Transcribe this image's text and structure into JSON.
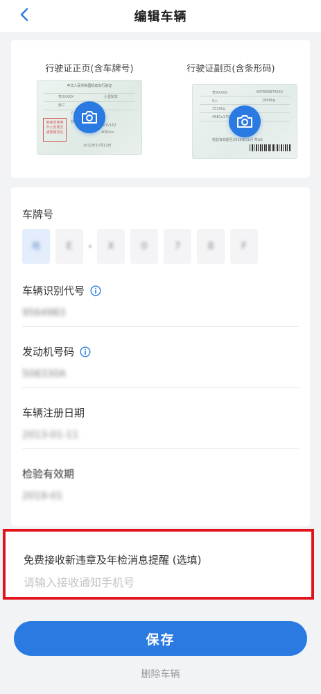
{
  "header": {
    "title": "编辑车辆",
    "back_icon": "back-chevron-icon"
  },
  "photos": {
    "front": {
      "label": "行驶证正页(含车牌号)",
      "sample_title": "中华人民共和国机动车行驶证",
      "sample_lines": [
        "粤XXXXX",
        "小型轿车",
        "张三",
        "广东省",
        "非营运",
        "2012年12月12日",
        "LVTV152",
        "4081cc"
      ],
      "stamp_text": "某某省某某市公安局交通警察支队",
      "icon": "camera-icon"
    },
    "back": {
      "label": "行驶证副页(含条形码)",
      "sample_lines": [
        "粤XXXXX",
        "5人",
        "1510kg",
        "4681x1750x1490mm",
        "847658876542",
        "1800kg",
        "检验有效期至2019年01月 粤AG"
      ],
      "icon": "camera-icon"
    }
  },
  "form": {
    "plate": {
      "label": "车牌号",
      "cells": [
        "粤",
        "E",
        "X",
        "0",
        "7",
        "8",
        "F"
      ]
    },
    "vin": {
      "label": "车辆识别代号",
      "value": "9564983",
      "icon": "info-icon"
    },
    "engine": {
      "label": "发动机号码",
      "value": "508330A",
      "icon": "info-icon"
    },
    "register_date": {
      "label": "车辆注册日期",
      "value": "2013-01-11"
    },
    "inspection": {
      "label": "检验有效期",
      "value": "2019-01"
    }
  },
  "notify": {
    "title": "免费接收新违章及年检消息提醒 (选填)",
    "placeholder": "请输入接收通知手机号",
    "highlight_color": "#e0141a"
  },
  "actions": {
    "save_label": "保存",
    "delete_label": "删除车辆"
  },
  "colors": {
    "accent": "#2a7ae2",
    "background": "#f2f3f5"
  }
}
